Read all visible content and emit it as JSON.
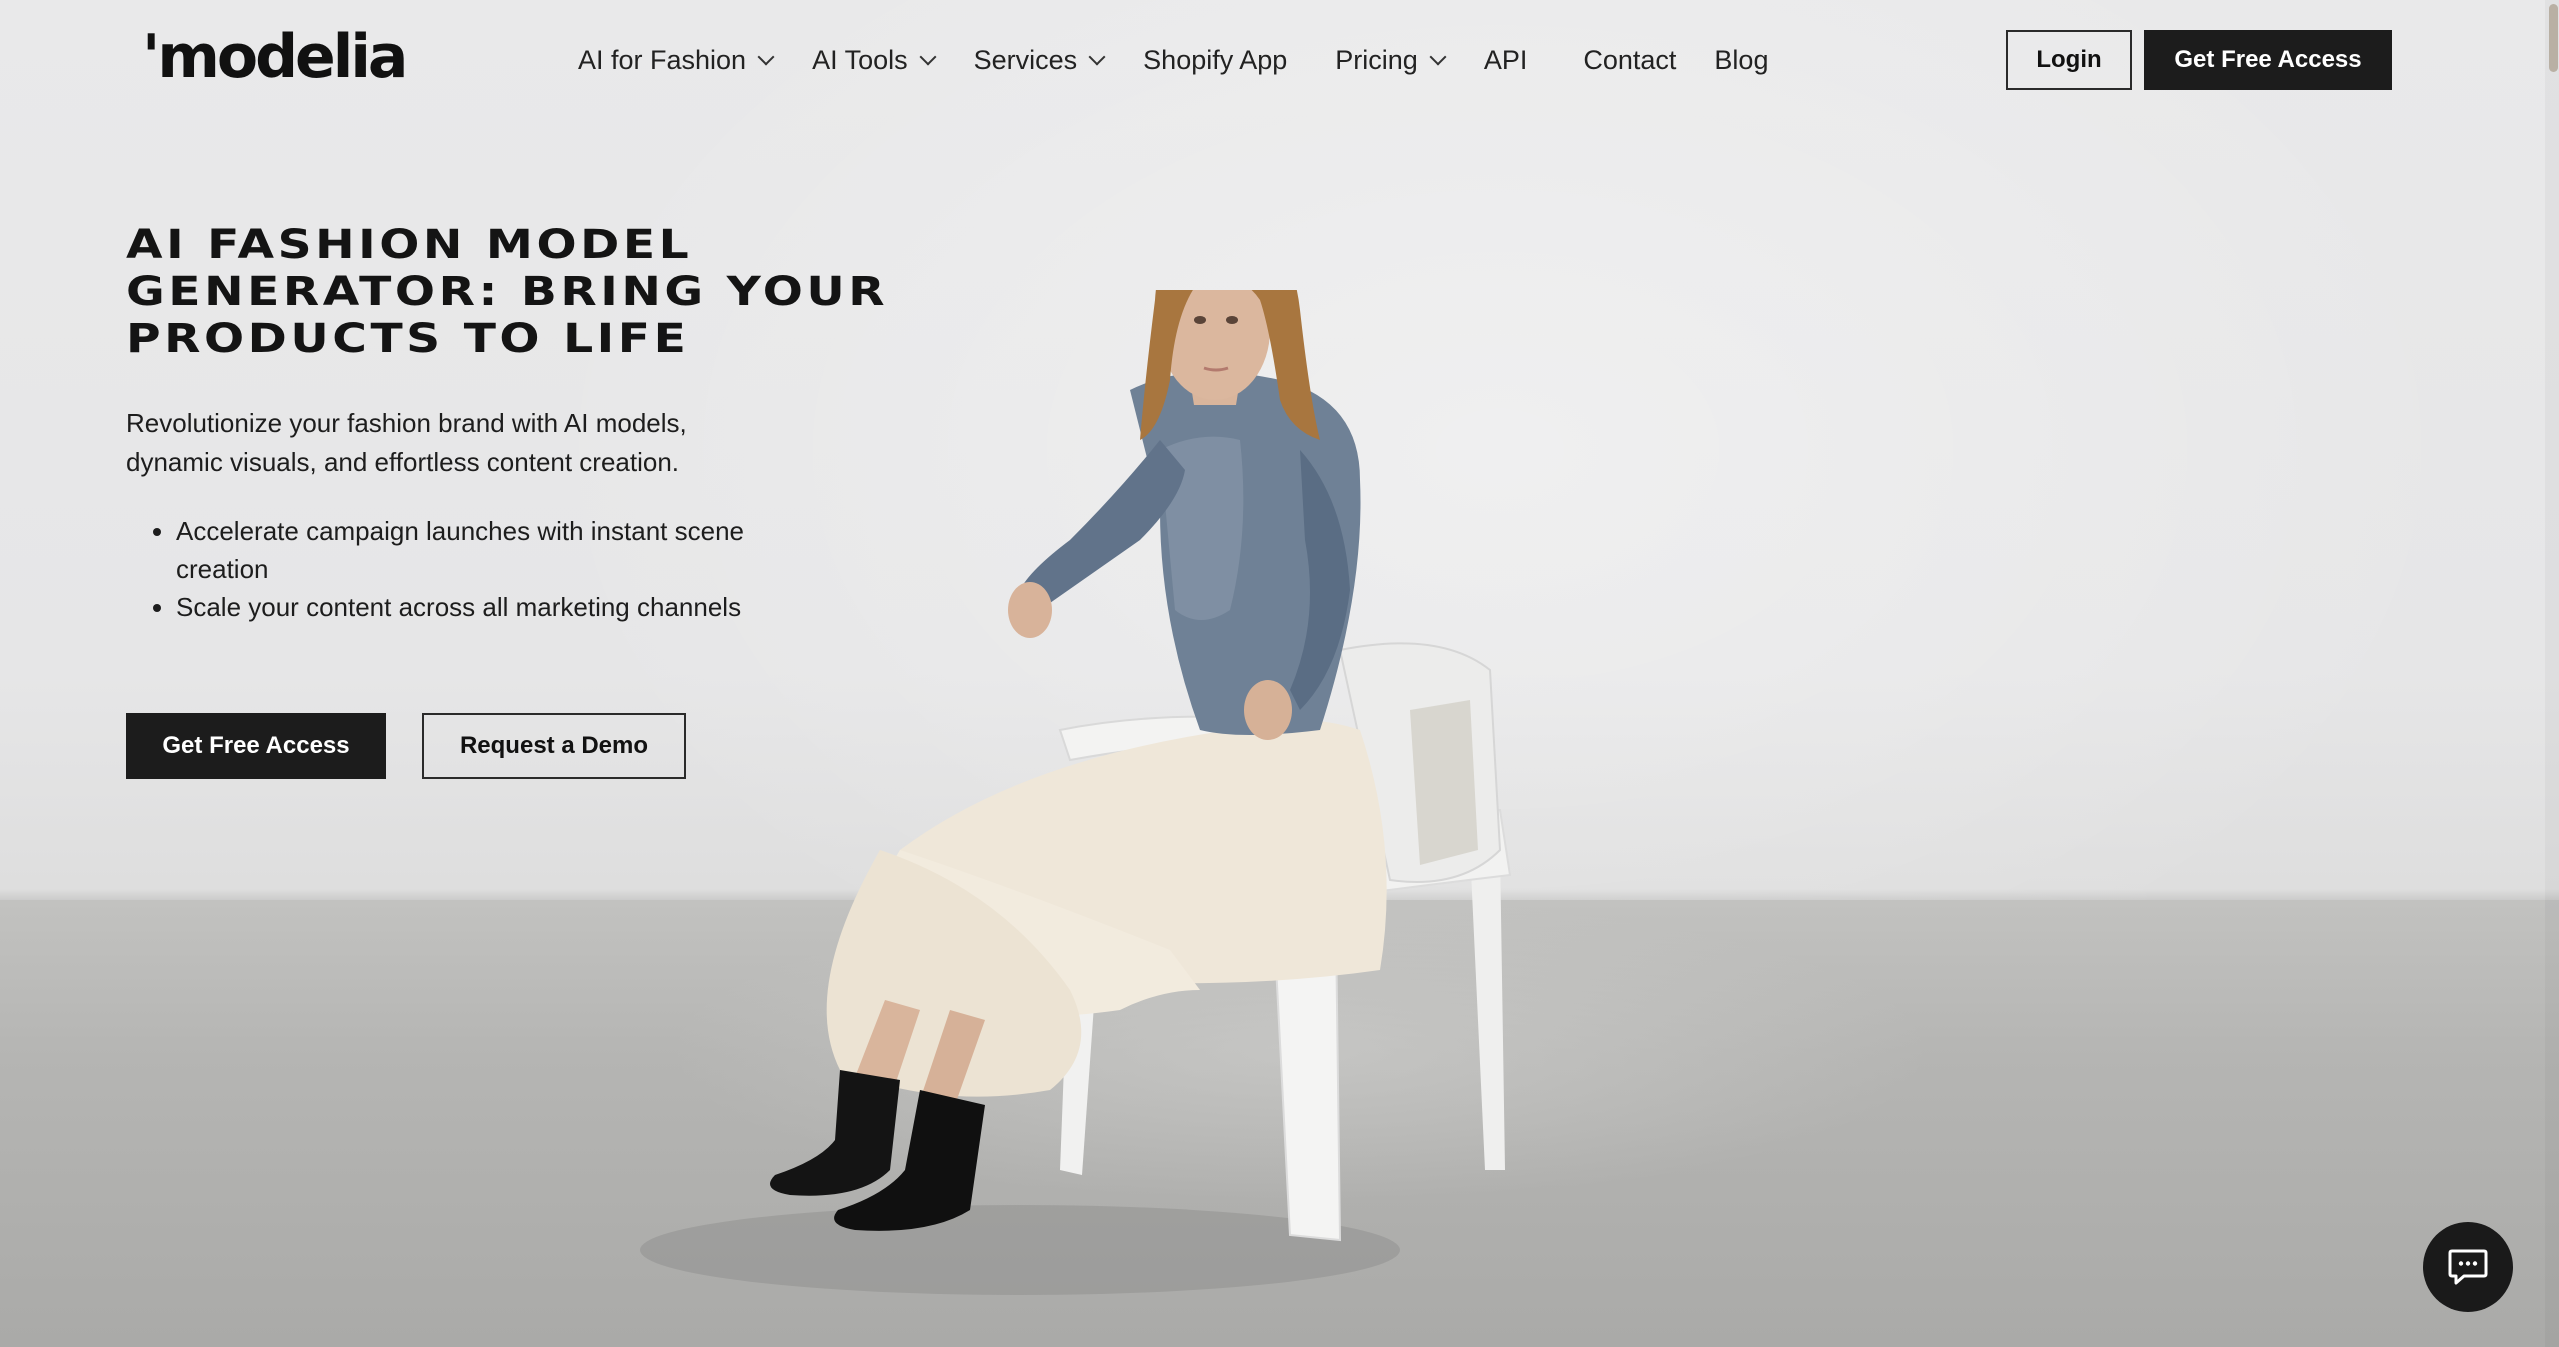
{
  "brand": {
    "logo_text": "'modelia"
  },
  "nav": {
    "items": [
      {
        "label": "AI for Fashion",
        "has_dropdown": true
      },
      {
        "label": "AI Tools",
        "has_dropdown": true
      },
      {
        "label": "Services",
        "has_dropdown": true
      },
      {
        "label": "Shopify App",
        "has_dropdown": false
      },
      {
        "label": "Pricing",
        "has_dropdown": true
      },
      {
        "label": "API",
        "has_dropdown": false
      },
      {
        "label": "Contact",
        "has_dropdown": false
      },
      {
        "label": "Blog",
        "has_dropdown": false
      }
    ],
    "login_label": "Login",
    "cta_label": "Get Free Access"
  },
  "hero": {
    "headline_lines": [
      "AI FASHION MODEL",
      "GENERATOR: BRING YOUR",
      "PRODUCTS TO LIFE"
    ],
    "subtitle_lines": [
      "Revolutionize your fashion brand with AI models,",
      "dynamic visuals, and effortless content creation."
    ],
    "bullets": [
      "Accelerate campaign launches with instant scene creation",
      "Scale your content across all marketing channels"
    ],
    "primary_cta": "Get Free Access",
    "secondary_cta": "Request a Demo"
  },
  "chat": {
    "icon": "chat-bubble-icon"
  },
  "colors": {
    "dark_button": "#1c1c1c",
    "background_wall": "#e6e6e7",
    "floor": "#b0b0ae",
    "scroll_thumb": "#b9b0a4"
  }
}
